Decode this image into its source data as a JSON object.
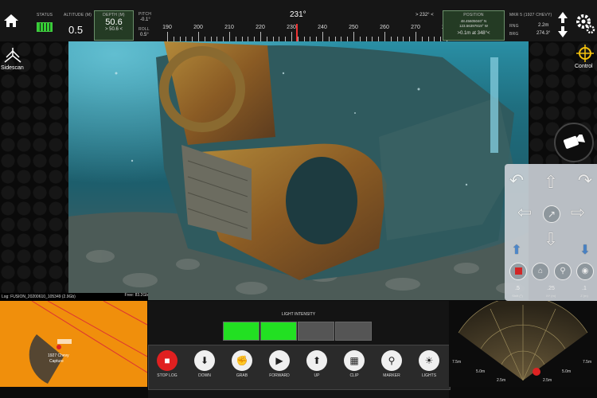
{
  "header": {
    "status_label": "STATUS",
    "altitude_label": "ALTITUDE (m)",
    "altitude_value": "0.5",
    "depth_label": "DEPTH (m)",
    "depth_value": "50.6",
    "depth_sub": "> 50.6 <",
    "pitch_label": "PITCH",
    "pitch_value": "-0.1°",
    "roll_label": "ROLL",
    "roll_value": "0.5°",
    "heading_value": "231°",
    "heading_target": "> 232° <",
    "compass_ticks": [
      "190",
      "200",
      "210",
      "220",
      "230",
      "240",
      "250",
      "260",
      "270",
      "280"
    ],
    "position_label": "POSITION",
    "position_lat": "48.45605040° N",
    "position_lon": "123.56397819° W",
    "position_sub": ">0.1m at 348°<",
    "marker_label": "MKR 5 (1927 CHEVY)",
    "rng_label": "Rng",
    "rng_value": "2.2m",
    "brg_label": "Brg",
    "brg_value": "274.3°"
  },
  "left": {
    "sidescan_label": "Sidescan"
  },
  "right": {
    "control_label": "Control"
  },
  "status_bar": {
    "log": "Log: FUSION_20200610_105349 (2.9Gb)",
    "free": "Free: 83.2Gb"
  },
  "pad": {
    "values": [
      ".5",
      ".25",
      ".1"
    ],
    "labels": [
      "Shift (°)",
      "XY (m)",
      "Z (m)"
    ]
  },
  "minimap": {
    "marker_label": "1927 Chevy",
    "capture_label": "Capture"
  },
  "lights": {
    "label": "LIGHT INTENSITY",
    "segments_on": 2,
    "segments_total": 4,
    "on_color": "#22e022",
    "off_color": "#555555"
  },
  "buttons": [
    {
      "label": "STOP LOG",
      "icon": "stop-icon"
    },
    {
      "label": "DOWN",
      "icon": "down-icon"
    },
    {
      "label": "GRAB",
      "icon": "grab-icon"
    },
    {
      "label": "FORWARD",
      "icon": "camera-forward-icon"
    },
    {
      "label": "UP",
      "icon": "up-icon"
    },
    {
      "label": "CLIP",
      "icon": "film-icon"
    },
    {
      "label": "MARKER",
      "icon": "map-pin-icon"
    },
    {
      "label": "LIGHTS",
      "icon": "bulb-icon"
    }
  ],
  "sonar": {
    "range_labels": [
      "7.5m",
      "5.0m",
      "2.5m",
      "2.5m",
      "5.0m",
      "7.5m"
    ]
  }
}
